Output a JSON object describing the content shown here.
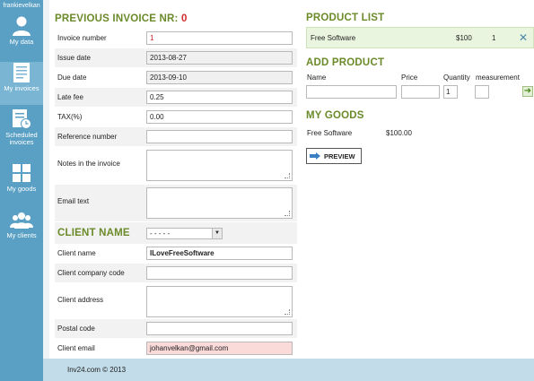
{
  "user": {
    "name": "frankievelkan"
  },
  "sidebar": {
    "items": [
      {
        "label": "My data"
      },
      {
        "label": "My invoices"
      },
      {
        "label": "Scheduled invoices"
      },
      {
        "label": "My goods"
      },
      {
        "label": "My clients"
      }
    ]
  },
  "invoice": {
    "title": "PREVIOUS INVOICE NR:",
    "number": "0",
    "fields": {
      "invoice_number_label": "Invoice number",
      "invoice_number": "1",
      "issue_date_label": "Issue date",
      "issue_date": "2013-08-27",
      "due_date_label": "Due date",
      "due_date": "2013-09-10",
      "late_fee_label": "Late fee",
      "late_fee": "0.25",
      "tax_label": "TAX(%)",
      "tax": "0.00",
      "reference_label": "Reference number",
      "reference": "",
      "notes_label": "Notes in the invoice",
      "notes": "",
      "email_text_label": "Email text",
      "email_text": ""
    }
  },
  "client": {
    "title": "CLIENT NAME",
    "select_value": "- - - - -",
    "name_label": "Client name",
    "name": "ILoveFreeSoftware",
    "company_label": "Client company code",
    "company": "",
    "address_label": "Client address",
    "address": "",
    "postal_label": "Postal code",
    "postal": "",
    "email_label": "Client email",
    "email": "johanvelkan@gmail.com"
  },
  "product_list": {
    "title": "PRODUCT LIST",
    "items": [
      {
        "name": "Free Software",
        "price": "$100",
        "qty": "1"
      }
    ]
  },
  "add_product": {
    "title": "ADD PRODUCT",
    "name_col": "Name",
    "price_col": "Price",
    "qty_col": "Quantity",
    "measure_col": "measurement",
    "qty_value": "1"
  },
  "goods": {
    "title": "MY GOODS",
    "items": [
      {
        "name": "Free Software",
        "price": "$100.00"
      }
    ]
  },
  "preview_label": "PREVIEW",
  "footer": "Inv24.com © 2013",
  "colors": {
    "sidebar": "#5aa0c4",
    "accent_green": "#6b8a2a",
    "red": "#d12b2b",
    "footer": "#c2dce9"
  }
}
